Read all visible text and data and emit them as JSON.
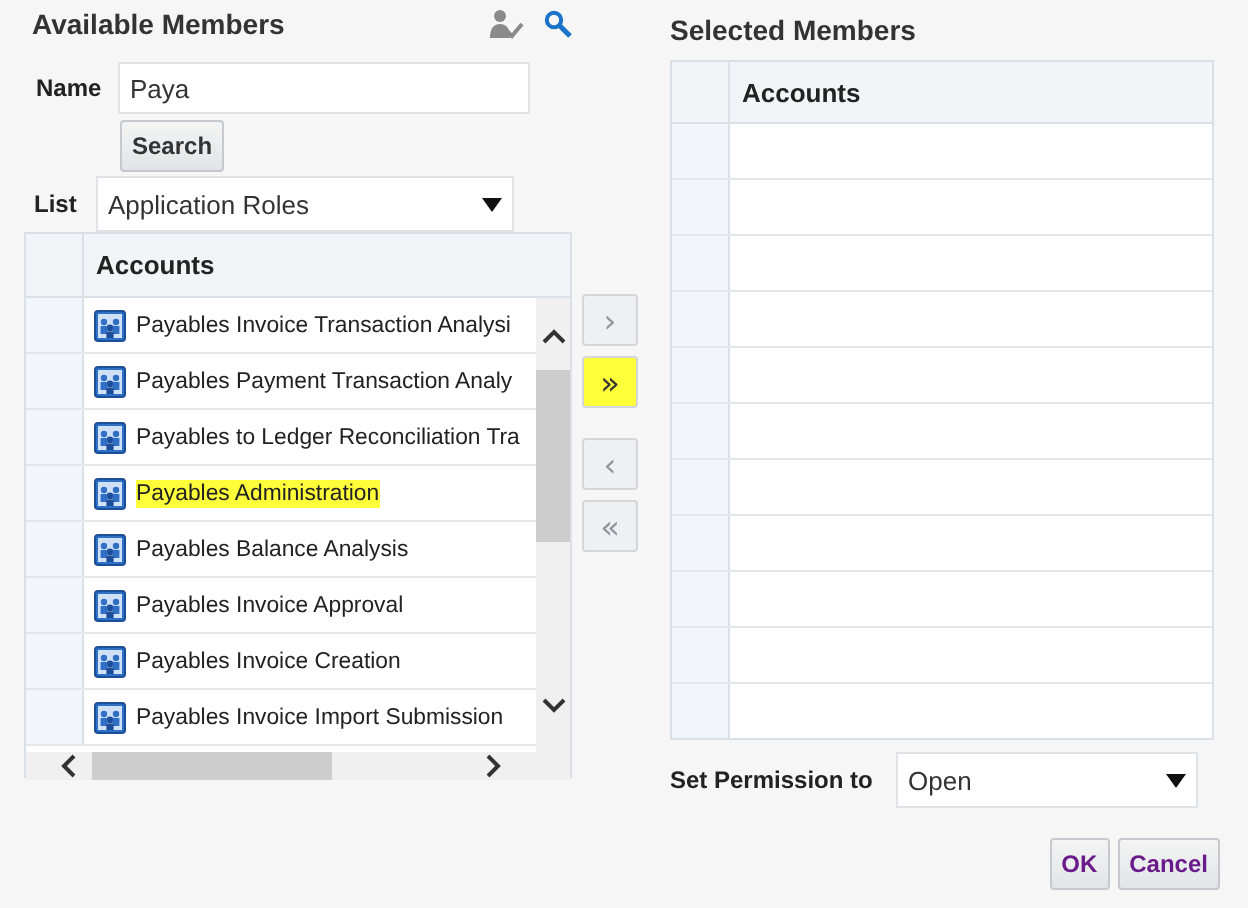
{
  "available": {
    "title": "Available Members",
    "name_label": "Name",
    "name_value": "Paya",
    "search_button": "Search",
    "list_label": "List",
    "list_value": "Application Roles",
    "table": {
      "columns": [
        "Accounts"
      ],
      "rows": [
        {
          "text": "Payables Invoice Transaction Analysi",
          "highlighted": false
        },
        {
          "text": "Payables Payment Transaction Analy",
          "highlighted": false
        },
        {
          "text": "Payables to Ledger Reconciliation Tra",
          "highlighted": false
        },
        {
          "text": "Payables Administration",
          "highlighted": true
        },
        {
          "text": "Payables Balance Analysis",
          "highlighted": false
        },
        {
          "text": "Payables Invoice Approval",
          "highlighted": false
        },
        {
          "text": "Payables Invoice Creation",
          "highlighted": false
        },
        {
          "text": "Payables Invoice Import Submission",
          "highlighted": false
        }
      ]
    }
  },
  "move_buttons": [
    {
      "label": "›",
      "disabled": true,
      "highlighted": false
    },
    {
      "label": "»",
      "disabled": false,
      "highlighted": true
    },
    {
      "label": "‹",
      "disabled": true,
      "highlighted": false
    },
    {
      "label": "«",
      "disabled": true,
      "highlighted": false
    }
  ],
  "selected": {
    "title": "Selected Members",
    "table": {
      "columns": [
        "Accounts"
      ]
    },
    "permission_label": "Set Permission to",
    "permission_value": "Open"
  },
  "buttons": [
    "OK",
    "Cancel"
  ]
}
